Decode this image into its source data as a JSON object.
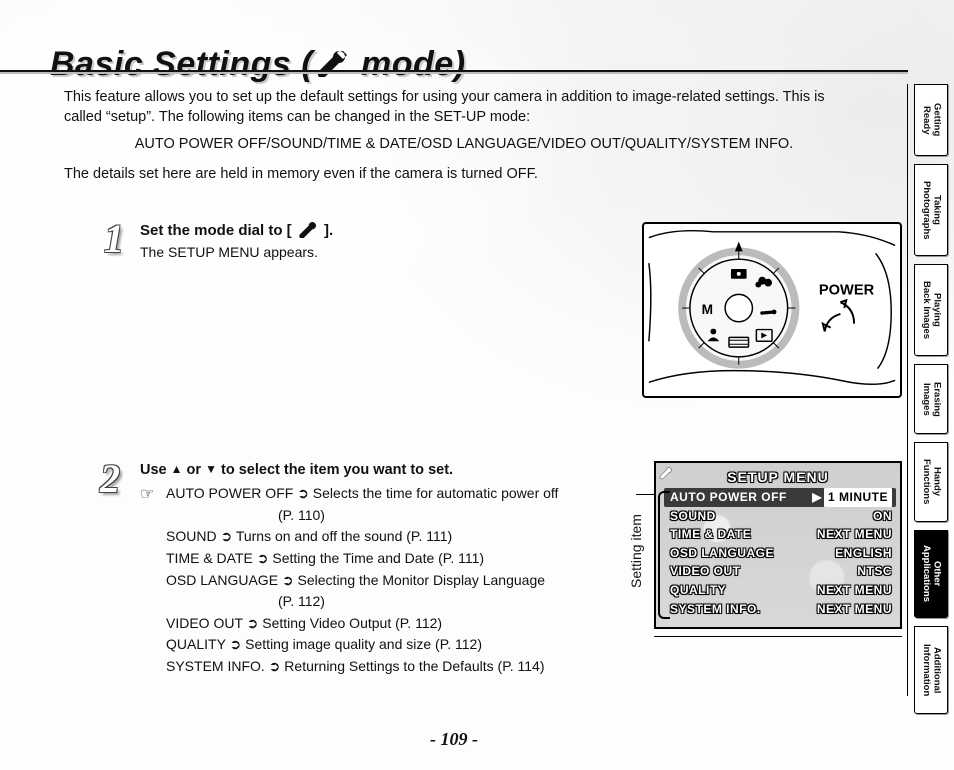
{
  "title_prefix": "Basic Settings (",
  "title_suffix": " mode)",
  "intro": {
    "p1": "This feature allows you to set up the default settings for using your camera in addition to image-related settings. This is called “setup”. The following items can be changed in the SET-UP mode:",
    "capline": "AUTO POWER OFF/SOUND/TIME & DATE/OSD LANGUAGE/VIDEO OUT/QUALITY/SYSTEM INFO.",
    "p2": "The details set here are held in memory even if the camera is turned OFF."
  },
  "step1": {
    "num": "1",
    "line1a": "Set the mode dial to [ ",
    "line1b": " ].",
    "line2": "The SETUP MENU appears."
  },
  "camera": {
    "power_label": "POWER"
  },
  "step2": {
    "num": "2",
    "headline_a": "Use ",
    "headline_b": " or ",
    "headline_c": " to select the item you want to set.",
    "hand": "☞",
    "items": [
      "AUTO POWER OFF ➲ Selects the time for automatic power off",
      "(P. 110)",
      "SOUND ➲ Turns on and off the sound (P. 111)",
      "TIME & DATE ➲ Setting the Time and Date (P. 111)",
      "OSD LANGUAGE ➲ Selecting the Monitor Display Language",
      "(P. 112)",
      "VIDEO OUT ➲ Setting Video Output (P. 112)",
      "QUALITY ➲ Setting image quality and size (P. 112)",
      "SYSTEM INFO. ➲ Returning Settings to the Defaults (P. 114)"
    ]
  },
  "setting_item_label": "Setting item",
  "setup_menu": {
    "title": "SETUP MENU",
    "rows": [
      {
        "k": "AUTO POWER OFF",
        "v": "1 MINUTE",
        "selected": true
      },
      {
        "k": "SOUND",
        "v": "ON"
      },
      {
        "k": "TIME & DATE",
        "v": "NEXT MENU"
      },
      {
        "k": "OSD LANGUAGE",
        "v": "ENGLISH"
      },
      {
        "k": "VIDEO OUT",
        "v": "NTSC"
      },
      {
        "k": "QUALITY",
        "v": "NEXT MENU"
      },
      {
        "k": "SYSTEM INFO.",
        "v": "NEXT MENU"
      }
    ]
  },
  "tabs": [
    "Getting\nReady",
    "Taking\nPhotographs",
    "Playing\nBack Images",
    "Erasing\nImages",
    "Handy\nFunctions",
    "Other\nApplications",
    "Additional\nInformation"
  ],
  "active_tab_index": 5,
  "page_number": "- 109 -"
}
